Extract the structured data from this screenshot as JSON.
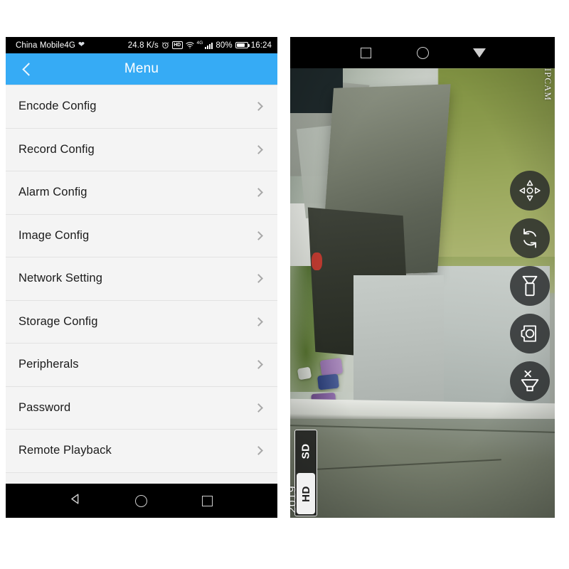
{
  "left_phone": {
    "status_bar": {
      "carrier": "China Mobile4G",
      "heart_icon": "heart-icon",
      "data_rate": "24.8 K/s",
      "alarm_icon": "alarm-clock-icon",
      "hd_badge": "HD",
      "wifi_icon": "wifi-icon",
      "signal_sup": "4G",
      "signal_icon": "signal-bars-icon",
      "battery_percent": "80%",
      "battery_icon": "battery-icon",
      "clock": "16:24"
    },
    "app_bar": {
      "back_icon": "chevron-left-icon",
      "title": "Menu"
    },
    "menu": {
      "items": [
        {
          "label": "Encode Config",
          "chevron": "chevron-right-icon"
        },
        {
          "label": "Record Config",
          "chevron": "chevron-right-icon"
        },
        {
          "label": "Alarm Config",
          "chevron": "chevron-right-icon"
        },
        {
          "label": "Image Config",
          "chevron": "chevron-right-icon"
        },
        {
          "label": "Network Setting",
          "chevron": "chevron-right-icon"
        },
        {
          "label": "Storage Config",
          "chevron": "chevron-right-icon"
        },
        {
          "label": "Peripherals",
          "chevron": "chevron-right-icon"
        },
        {
          "label": "Password",
          "chevron": "chevron-right-icon"
        },
        {
          "label": "Remote Playback",
          "chevron": "chevron-right-icon"
        }
      ]
    },
    "nav_bar": {
      "back": "back-triangle-icon",
      "home": "home-circle-icon",
      "recents": "recents-square-icon"
    }
  },
  "right_phone": {
    "nav_bar": {
      "recents": "recents-square-icon",
      "home": "home-circle-icon",
      "back": "back-triangle-down-icon"
    },
    "video": {
      "osd_camera_name": "IPCAM",
      "osd_date": "2019",
      "quality": {
        "options": [
          "SD",
          "HD"
        ],
        "selected": "HD"
      },
      "controls": [
        {
          "name": "ptz-dpad-button",
          "label": "PTZ"
        },
        {
          "name": "rotate-refresh-button",
          "label": "Rotate"
        },
        {
          "name": "speaker-talk-button",
          "label": "Talk"
        },
        {
          "name": "snapshot-camera-button",
          "label": "Snapshot"
        },
        {
          "name": "mute-speaker-button",
          "label": "Mute"
        }
      ]
    }
  },
  "colors": {
    "accent_blue": "#36abf5",
    "list_bg": "#f4f4f4",
    "divider": "#e2e2e2",
    "nav_black": "#000000",
    "chevron_gray": "#a8a8a8"
  }
}
